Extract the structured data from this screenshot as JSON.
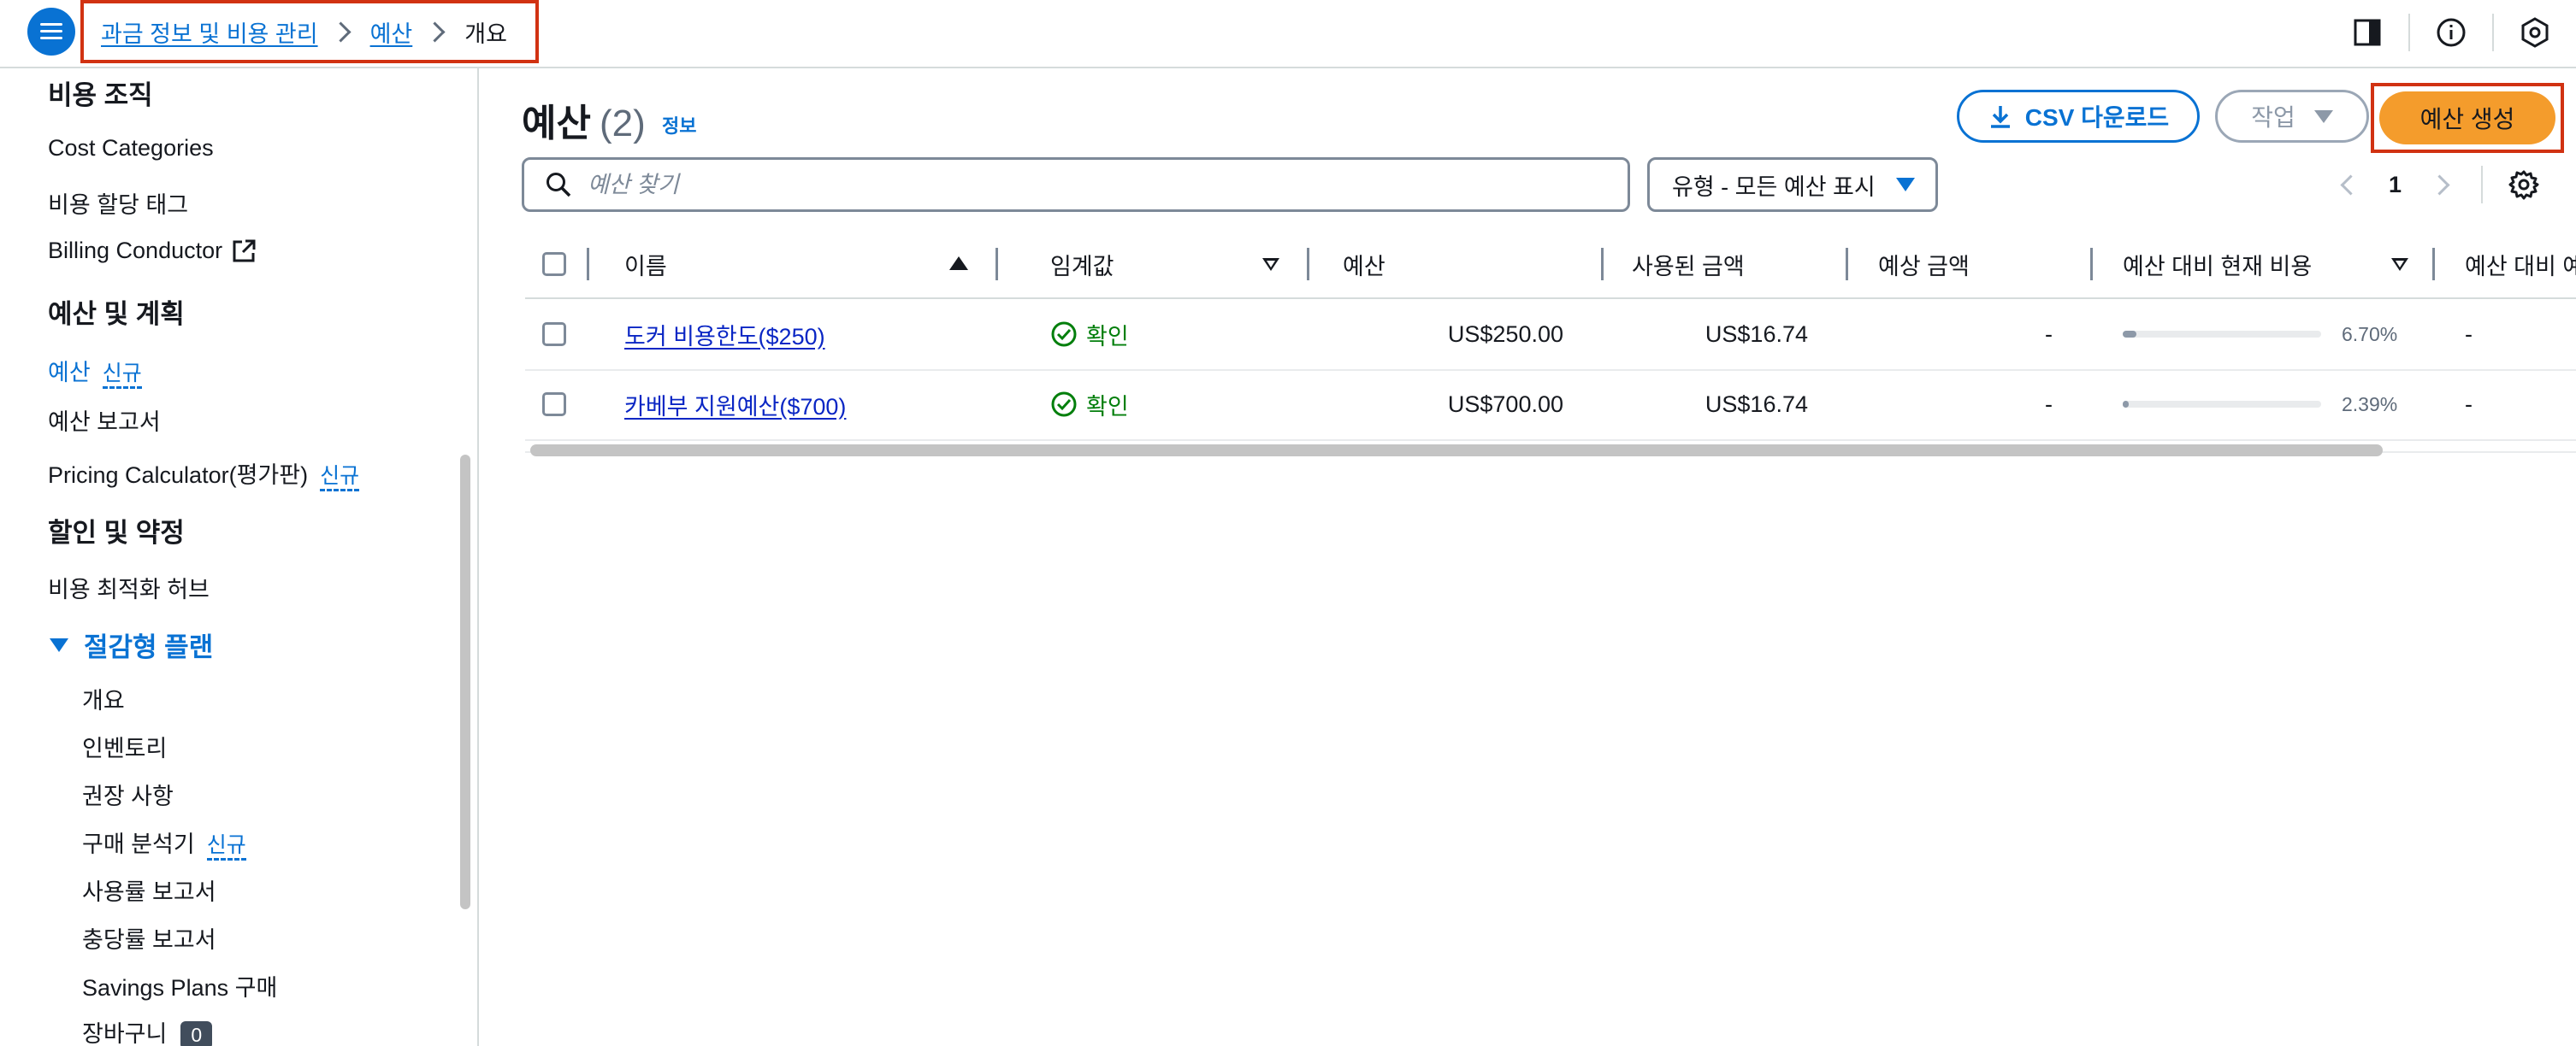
{
  "breadcrumb": {
    "items": [
      "과금 정보 및 비용 관리",
      "예산"
    ],
    "current": "개요"
  },
  "sidebar": {
    "heading_cost_org": "비용 조직",
    "cost_categories": "Cost Categories",
    "cost_alloc_tags": "비용 할당 태그",
    "billing_conductor": "Billing Conductor",
    "heading_budgets_planning": "예산 및 계획",
    "budgets": "예산",
    "budgets_badge": "신규",
    "budget_reports": "예산 보고서",
    "pricing_calculator": "Pricing Calculator(평가판)",
    "pricing_badge": "신규",
    "heading_discounts": "할인 및 약정",
    "cost_opt_hub": "비용 최적화 허브",
    "savings_plans_section": "절감형 플랜",
    "sp_overview": "개요",
    "sp_inventory": "인벤토리",
    "sp_recommendations": "권장 사항",
    "sp_purchase_analyzer": "구매 분석기",
    "sp_purchase_badge": "신규",
    "sp_utilization": "사용률 보고서",
    "sp_coverage": "충당률 보고서",
    "sp_purchase": "Savings Plans 구매",
    "sp_cart": "장바구니",
    "sp_cart_count": "0"
  },
  "header": {
    "title": "예산",
    "count": "(2)",
    "info": "정보"
  },
  "toolbar": {
    "csv_label": "CSV 다운로드",
    "action_label": "작업",
    "create_label": "예산 생성"
  },
  "search": {
    "placeholder": "예산 찾기"
  },
  "filter": {
    "selected": "유형 - 모든 예산 표시"
  },
  "pagination": {
    "page": "1"
  },
  "table": {
    "columns": [
      "이름",
      "임계값",
      "예산",
      "사용된 금액",
      "예상 금액",
      "예산 대비 현재 비용",
      "예산 대비 예상"
    ],
    "rows": [
      {
        "name": "도커 비용한도($250)",
        "threshold": "확인",
        "budget": "US$250.00",
        "used": "US$16.74",
        "forecast": "-",
        "current_pct": "6.70%",
        "current_pct_value": 6.7,
        "forecast_vs_budget": "-"
      },
      {
        "name": "카베부 지원예산($700)",
        "threshold": "확인",
        "budget": "US$700.00",
        "used": "US$16.74",
        "forecast": "-",
        "current_pct": "2.39%",
        "current_pct_value": 2.39,
        "forecast_vs_budget": "-"
      }
    ]
  },
  "colors": {
    "accent": "#0972d3",
    "primary_button": "#f49c2c",
    "success": "#037f0c",
    "highlight_border": "#d13212"
  }
}
